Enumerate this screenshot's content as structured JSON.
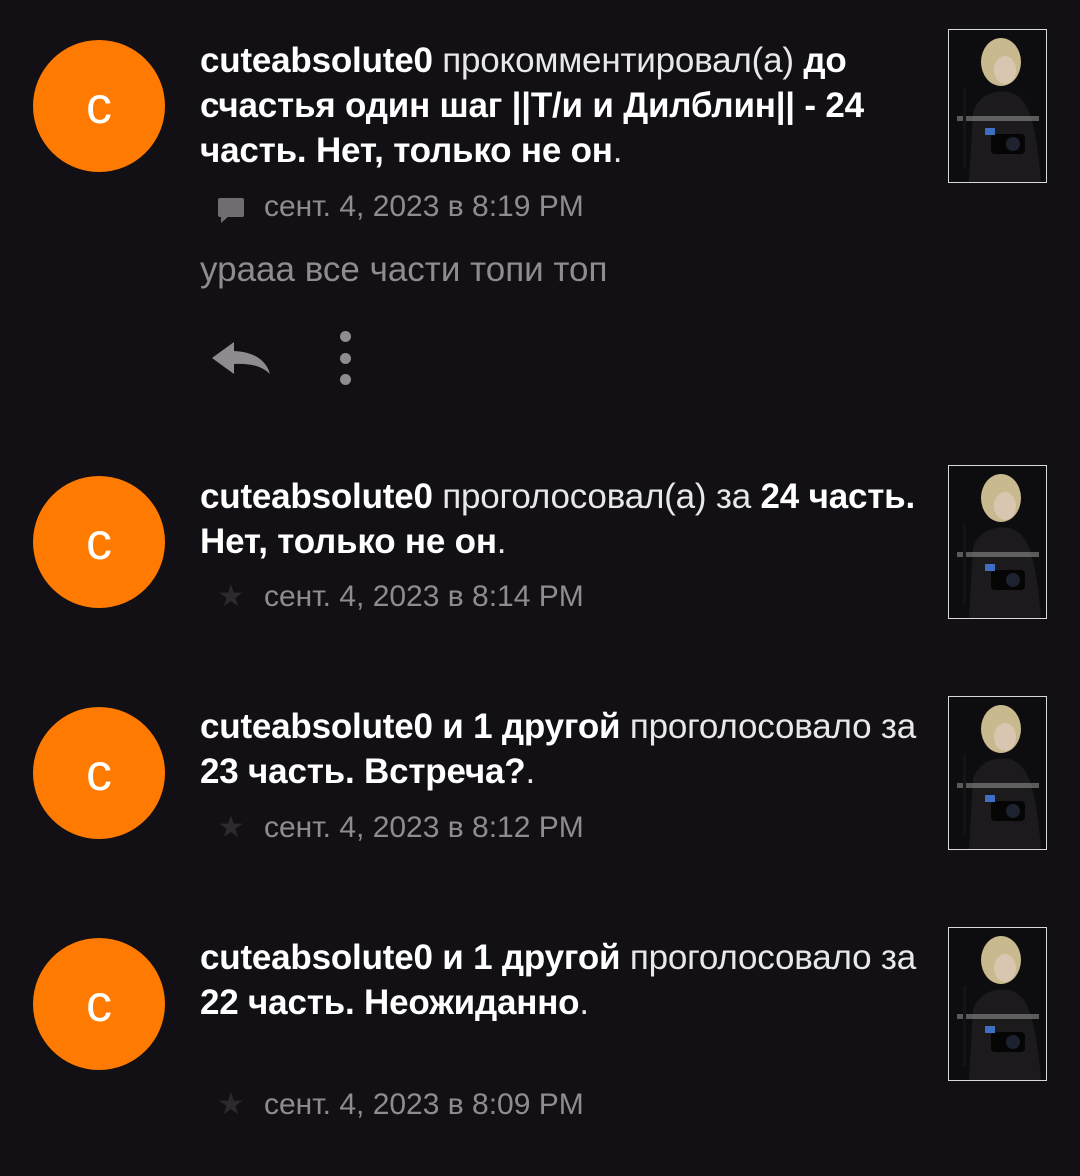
{
  "notifications": [
    {
      "avatar_letter": "c",
      "username": "cuteabsolute0",
      "action": " прокомментировал(а) ",
      "target": "до счастья один шаг ||Т/и и Дилблин|| - 24 часть. Нет, только не он",
      "tail": ".",
      "meta_icon": "comment-icon",
      "timestamp": "сент. 4, 2023 в 8:19 PM",
      "comment": "урааа все части топи топ"
    },
    {
      "avatar_letter": "c",
      "username": "cuteabsolute0",
      "action": " проголосовал(а) за ",
      "target": "24 часть. Нет, только не он",
      "tail": ".",
      "meta_icon": "star-icon",
      "timestamp": "сент. 4, 2023 в 8:14 PM"
    },
    {
      "avatar_letter": "c",
      "username": "cuteabsolute0 и 1 другой",
      "action": " проголосовало за ",
      "target": "23 часть. Встреча?",
      "tail": ".",
      "meta_icon": "star-icon",
      "timestamp": "сент. 4, 2023 в 8:12 PM"
    },
    {
      "avatar_letter": "c",
      "username": "cuteabsolute0 и 1 другой",
      "action": " проголосовало за ",
      "target": "22 часть. Неожиданно",
      "tail": ".",
      "meta_icon": "star-icon",
      "timestamp": "сент. 4, 2023 в 8:09 PM"
    }
  ],
  "colors": {
    "background": "#121014",
    "avatar": "#ff7a00",
    "muted_text": "#8e8c90"
  }
}
